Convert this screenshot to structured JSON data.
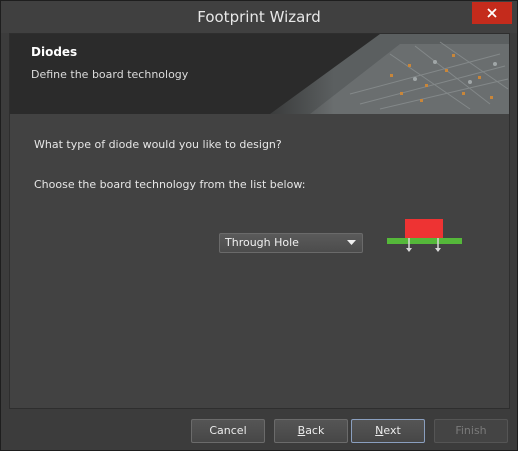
{
  "window": {
    "title": "Footprint Wizard"
  },
  "banner": {
    "title": "Diodes",
    "subtitle": "Define the board technology"
  },
  "content": {
    "question": "What type of diode would you like to design?",
    "instruction": "Choose the board technology from the list below:",
    "technology_select": {
      "value": "Through Hole"
    }
  },
  "buttons": {
    "cancel": "Cancel",
    "back_first": "B",
    "back_rest": "ack",
    "next_first": "N",
    "next_rest": "ext",
    "finish": "Finish"
  },
  "colors": {
    "close_button": "#c42b1c",
    "pad_red": "#ee3333",
    "board_green": "#55b83a"
  },
  "icons": {
    "close": "close-icon",
    "dropdown": "chevron-down-icon"
  }
}
